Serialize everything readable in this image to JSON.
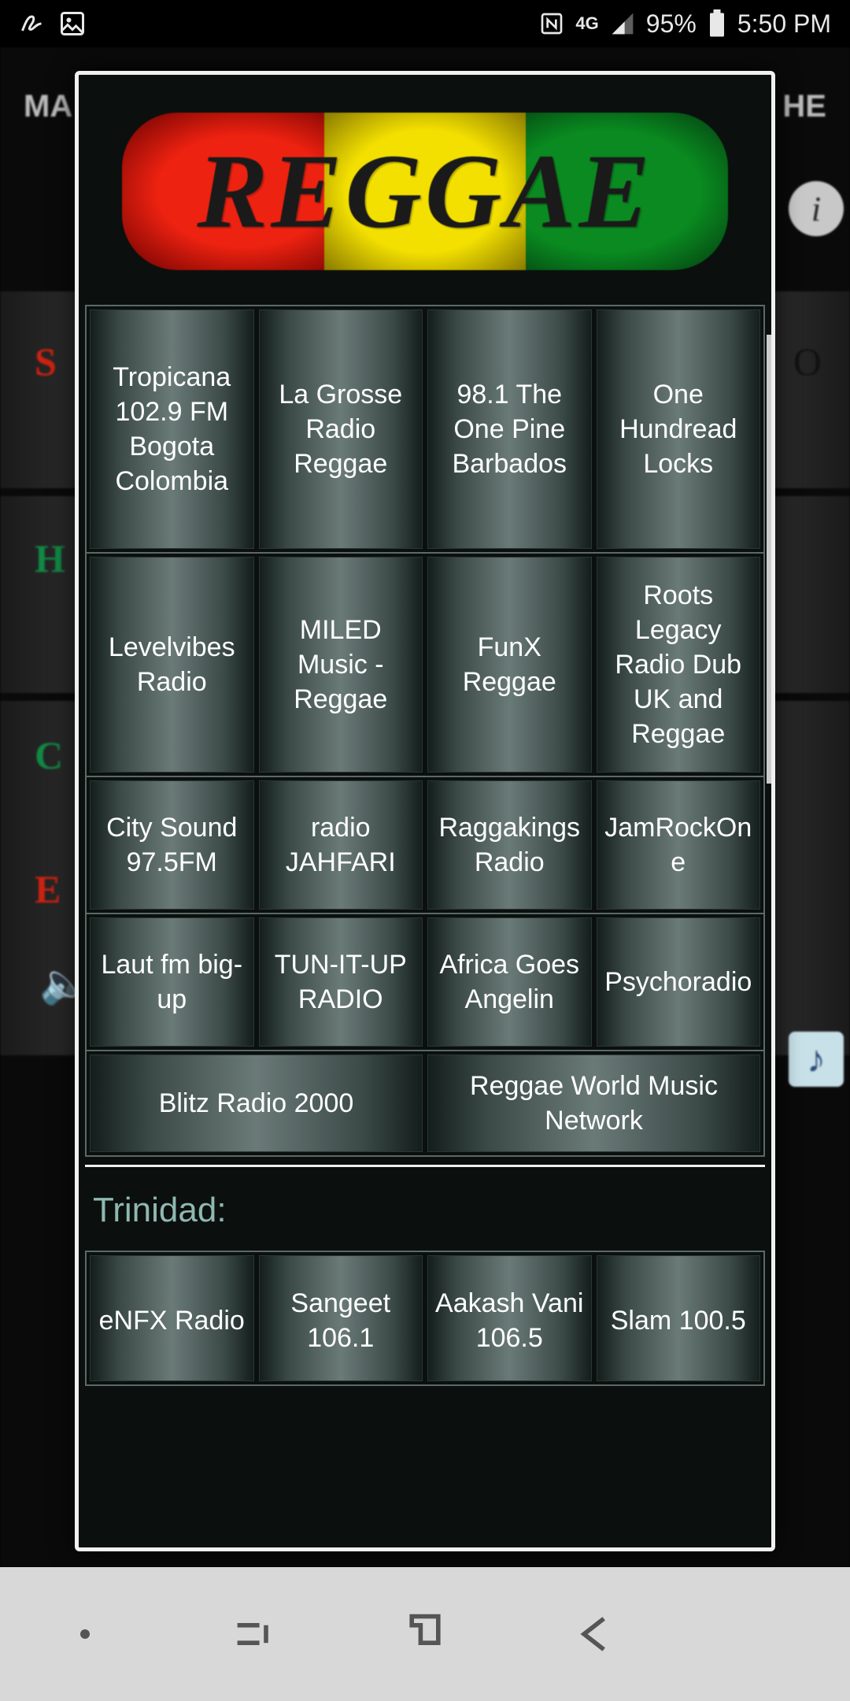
{
  "statusbar": {
    "battery_pct": "95%",
    "time": "5:50 PM",
    "lte_label": "4G"
  },
  "background_tabs": {
    "left": "MA",
    "right": "HE"
  },
  "bg_letters": [
    "S",
    "H",
    "C",
    "E"
  ],
  "bg_right_letter": "O",
  "dialog": {
    "banner_text": "REGGAE",
    "main_grid": [
      [
        "Tropicana 102.9 FM Bogota Colombia",
        "La Grosse Radio Reggae",
        "98.1 The One Pine Barbados",
        "One Hundread Locks"
      ],
      [
        "Levelvibes Radio",
        "MILED Music - Reggae",
        "FunX Reggae",
        "Roots Legacy Radio Dub UK and Reggae"
      ],
      [
        "City Sound 97.5FM",
        "radio JAHFARI",
        "Raggakings Radio",
        "JamRockOne"
      ],
      [
        "Laut fm big-up",
        "TUN-IT-UP RADIO",
        "Africa Goes Angelin",
        "Psychoradio"
      ],
      [
        "Blitz Radio 2000",
        "Reggae World Music Network"
      ]
    ],
    "section2_label": "Trinidad:",
    "trinidad_grid": [
      [
        "eNFX Radio",
        "Sangeet 106.1",
        "Aakash Vani 106.5",
        "Slam 100.5"
      ]
    ]
  }
}
